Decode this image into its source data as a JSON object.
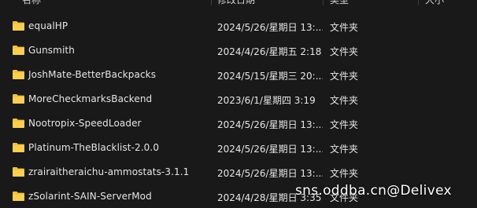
{
  "columns": {
    "name": "名称",
    "date": "修改日期",
    "type": "类型",
    "size": "大小"
  },
  "rows": [
    {
      "name": "equalHP",
      "date": "2024/5/26/星期日 13:...",
      "type": "文件夹"
    },
    {
      "name": "Gunsmith",
      "date": "2024/4/26/星期五 2:18",
      "type": "文件夹"
    },
    {
      "name": "JoshMate-BetterBackpacks",
      "date": "2024/5/15/星期三 20:...",
      "type": "文件夹"
    },
    {
      "name": "MoreCheckmarksBackend",
      "date": "2023/6/1/星期四 3:19",
      "type": "文件夹"
    },
    {
      "name": "Nootropix-SpeedLoader",
      "date": "2024/5/26/星期日 13:...",
      "type": "文件夹"
    },
    {
      "name": "Platinum-TheBlacklist-2.0.0",
      "date": "2024/5/26/星期日 13:...",
      "type": "文件夹"
    },
    {
      "name": "zrairaitheraichu-ammostats-3.1.1",
      "date": "2024/5/26/星期日 13:...",
      "type": "文件夹"
    },
    {
      "name": "zSolarint-SAIN-ServerMod",
      "date": "2024/4/28/星期日 3:35",
      "type": "文件夹"
    }
  ],
  "watermark": "sns.oddba.cn@Delivex",
  "colors": {
    "background": "#191919",
    "folder": "#f3c13a",
    "text": "#e6e6e6"
  },
  "icons": {
    "folder": "folder-icon"
  }
}
